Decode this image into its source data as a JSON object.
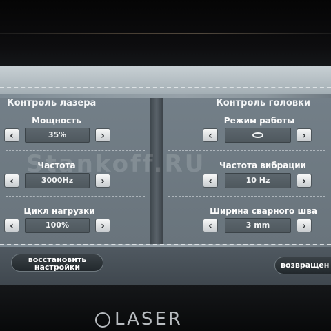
{
  "laser_control": {
    "title": "Контроль лазера",
    "power": {
      "label": "Мощность",
      "value": "35%"
    },
    "frequency": {
      "label": "Частота",
      "value": "3000Hz"
    },
    "duty_cycle": {
      "label": "Цикл нагрузки",
      "value": "100%"
    }
  },
  "head_control": {
    "title": "Контроль головки",
    "mode": {
      "label": "Режим работы",
      "value_icon": "ellipse-mode-icon"
    },
    "vibration_frequency": {
      "label": "Частота вибрации",
      "value": "10 Hz"
    },
    "seam_width": {
      "label": "Ширина сварного шва",
      "value": "3 mm"
    }
  },
  "footer": {
    "restore_line1": "восстановить",
    "restore_line2": "настройки",
    "back_label": "возвращен"
  },
  "icons": {
    "left_arrow": "‹",
    "right_arrow": "›"
  },
  "watermark": "Stankoff.RU",
  "brand": {
    "logo_text": "LASER"
  },
  "colors": {
    "panel": "#6e7a82",
    "button": "#eef0f1",
    "value_box": "#566067"
  }
}
